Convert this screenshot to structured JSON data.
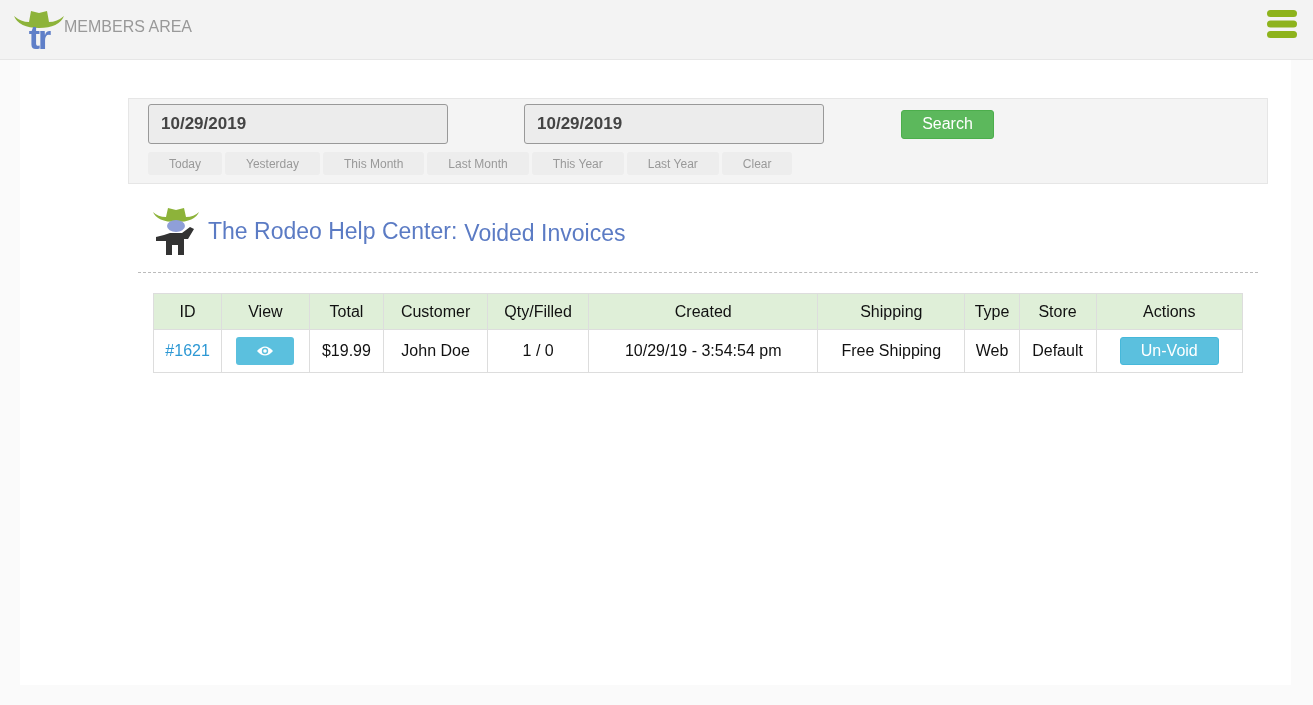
{
  "header": {
    "logo_text": "tr",
    "title": "MEMBERS AREA"
  },
  "filter": {
    "date_from": "10/29/2019",
    "date_to": "10/29/2019",
    "search_button": "Search",
    "presets": [
      "Today",
      "Yesterday",
      "This Month",
      "Last Month",
      "This Year",
      "Last Year",
      "Clear"
    ]
  },
  "heading": {
    "site": "The Rodeo Help Center:",
    "page": "Voided Invoices"
  },
  "table": {
    "columns": [
      "ID",
      "View",
      "Total",
      "Customer",
      "Qty/Filled",
      "Created",
      "Shipping",
      "Type",
      "Store",
      "Actions"
    ],
    "rows": [
      {
        "id": "#1621",
        "total": "$19.99",
        "customer": "John Doe",
        "qty_filled": "1 / 0",
        "created": "10/29/19 - 3:54:54 pm",
        "shipping": "Free Shipping",
        "type": "Web",
        "store": "Default",
        "action": "Un-Void"
      }
    ]
  }
}
